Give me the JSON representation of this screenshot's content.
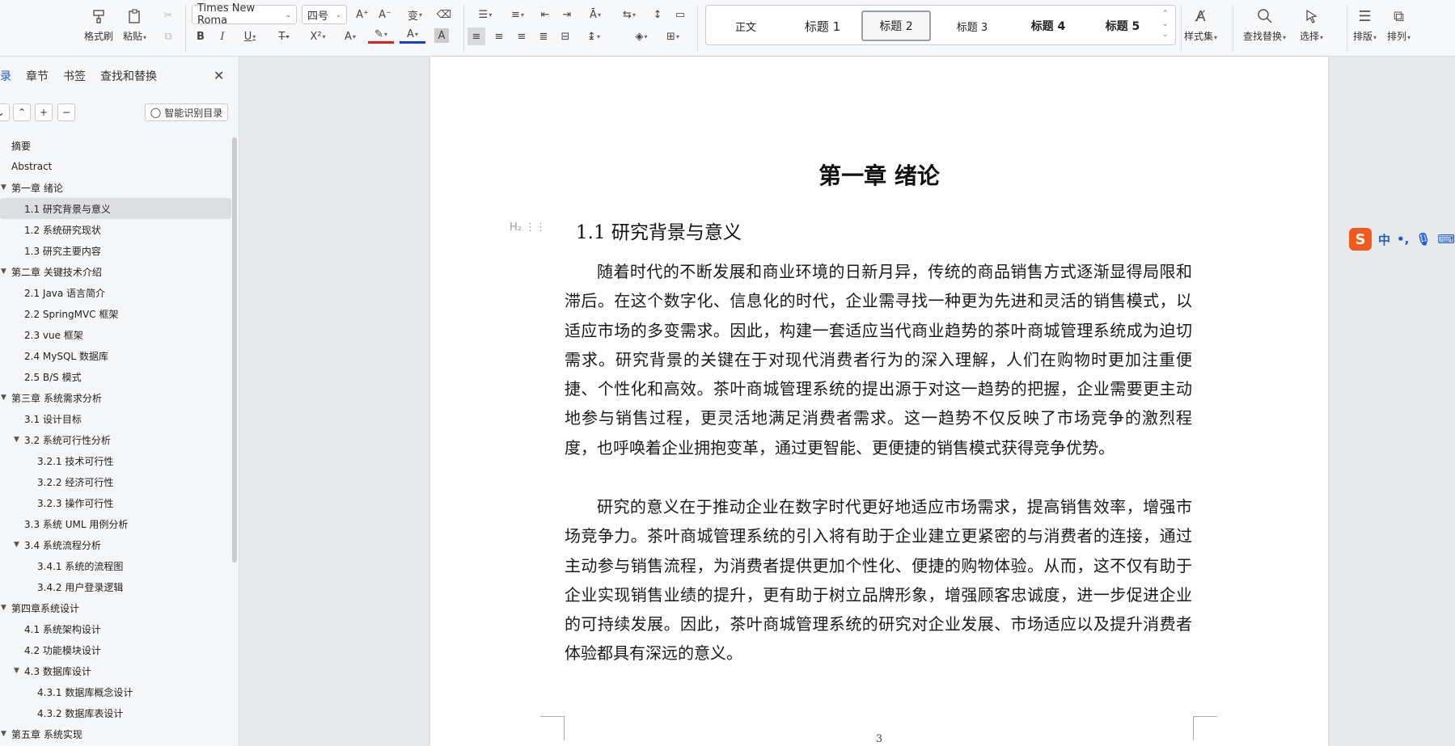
{
  "ribbon": {
    "format_painter": "格式刷",
    "paste": "粘贴",
    "font_name": "Times New Roma",
    "font_size": "四号",
    "styles": [
      "正文",
      "标题 1",
      "标题 2",
      "标题 3",
      "标题 4",
      "标题 5"
    ],
    "style_set": "样式集",
    "find_replace": "查找替换",
    "select": "选择",
    "layout": "排版",
    "arrange": "排列"
  },
  "sidebar": {
    "tabs": [
      "录",
      "章节",
      "书签",
      "查找和替换"
    ],
    "smart_toc": "智能识别目录",
    "items": [
      {
        "label": "摘要",
        "level": 0,
        "arrow": false
      },
      {
        "label": "Abstract",
        "level": 0,
        "arrow": false
      },
      {
        "label": "第一章  绪论",
        "level": 0,
        "arrow": true
      },
      {
        "label": "1.1 研究背景与意义",
        "level": 1,
        "arrow": false
      },
      {
        "label": "1.2 系统研究现状",
        "level": 1,
        "arrow": false
      },
      {
        "label": "1.3 研究主要内容",
        "level": 1,
        "arrow": false
      },
      {
        "label": "第二章  关键技术介绍",
        "level": 0,
        "arrow": true
      },
      {
        "label": "2.1 Java 语言简介",
        "level": 1,
        "arrow": false
      },
      {
        "label": "2.2 SpringMVC 框架",
        "level": 1,
        "arrow": false
      },
      {
        "label": "2.3 vue 框架",
        "level": 1,
        "arrow": false
      },
      {
        "label": "2.4 MySQL 数据库",
        "level": 1,
        "arrow": false
      },
      {
        "label": "2.5 B/S 模式",
        "level": 1,
        "arrow": false
      },
      {
        "label": "第三章  系统需求分析",
        "level": 0,
        "arrow": true
      },
      {
        "label": "3.1 设计目标",
        "level": 1,
        "arrow": false
      },
      {
        "label": "3.2 系统可行性分析",
        "level": 1,
        "arrow": true
      },
      {
        "label": "3.2.1 技术可行性",
        "level": 2,
        "arrow": false
      },
      {
        "label": "3.2.2 经济可行性",
        "level": 2,
        "arrow": false
      },
      {
        "label": "3.2.3 操作可行性",
        "level": 2,
        "arrow": false
      },
      {
        "label": "3.3 系统 UML 用例分析",
        "level": 1,
        "arrow": false
      },
      {
        "label": "3.4 系统流程分析",
        "level": 1,
        "arrow": true
      },
      {
        "label": "3.4.1 系统的流程图",
        "level": 2,
        "arrow": false
      },
      {
        "label": "3.4.2 用户登录逻辑",
        "level": 2,
        "arrow": false
      },
      {
        "label": "第四章系统设计",
        "level": 0,
        "arrow": true
      },
      {
        "label": "4.1  系统架构设计",
        "level": 1,
        "arrow": false
      },
      {
        "label": "4.2 功能模块设计",
        "level": 1,
        "arrow": false
      },
      {
        "label": "4.3  数据库设计",
        "level": 1,
        "arrow": true
      },
      {
        "label": "4.3.1 数据库概念设计",
        "level": 2,
        "arrow": false
      },
      {
        "label": "4.3.2  数据库表设计",
        "level": 2,
        "arrow": false
      },
      {
        "label": "第五章  系统实现",
        "level": 0,
        "arrow": true
      }
    ]
  },
  "document": {
    "chapter_title": "第一章  绪论",
    "heading_marker": "H₂",
    "section_title": "1.1 研究背景与意义",
    "paragraph1": "随着时代的不断发展和商业环境的日新月异，传统的商品销售方式逐渐显得局限和滞后。在这个数字化、信息化的时代，企业需寻找一种更为先进和灵活的销售模式，以适应市场的多变需求。因此，构建一套适应当代商业趋势的茶叶商城管理系统成为迫切需求。研究背景的关键在于对现代消费者行为的深入理解，人们在购物时更加注重便捷、个性化和高效。茶叶商城管理系统的提出源于对这一趋势的把握，企业需要更主动地参与销售过程，更灵活地满足消费者需求。这一趋势不仅反映了市场竞争的激烈程度，也呼唤着企业拥抱变革，通过更智能、更便捷的销售模式获得竞争优势。",
    "paragraph2": "研究的意义在于推动企业在数字时代更好地适应市场需求，提高销售效率，增强市场竞争力。茶叶商城管理系统的引入将有助于企业建立更紧密的与消费者的连接，通过主动参与销售流程，为消费者提供更加个性化、便捷的购物体验。从而，这不仅有助于企业实现销售业绩的提升，更有助于树立品牌形象，增强顾客忠诚度，进一步促进企业的可持续发展。因此，茶叶商城管理系统的研究对企业发展、市场适应以及提升消费者体验都具有深远的意义。",
    "page_number": "3"
  },
  "ime": {
    "mode": "中",
    "punct": "•,"
  }
}
